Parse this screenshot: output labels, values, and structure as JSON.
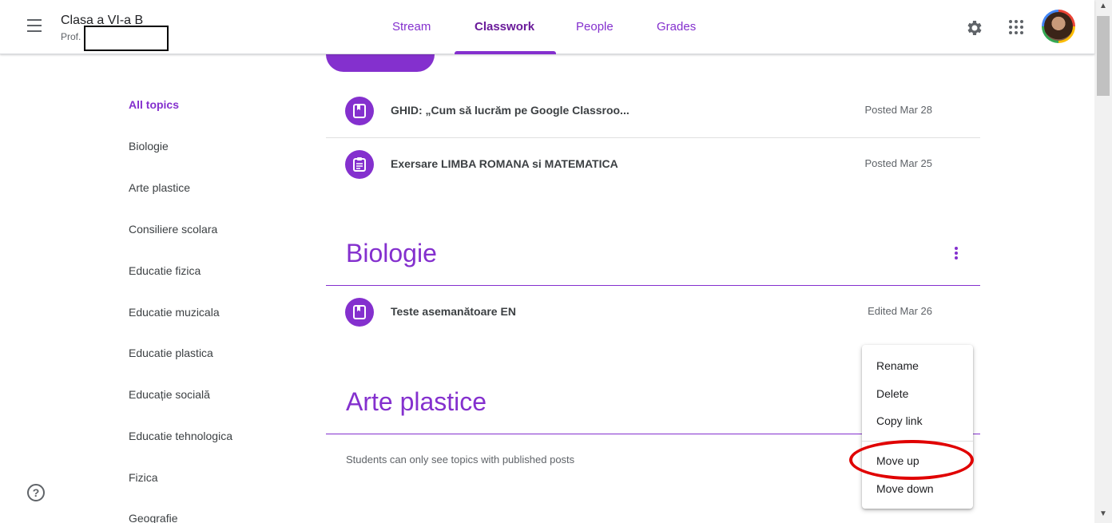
{
  "header": {
    "class_name": "Clasa a VI-a B",
    "teacher_prefix": "Prof.",
    "tabs": [
      {
        "label": "Stream"
      },
      {
        "label": "Classwork"
      },
      {
        "label": "People"
      },
      {
        "label": "Grades"
      }
    ],
    "active_tab": "Classwork"
  },
  "topics": {
    "items": [
      {
        "label": "All topics"
      },
      {
        "label": "Biologie"
      },
      {
        "label": "Arte plastice"
      },
      {
        "label": "Consiliere scolara"
      },
      {
        "label": "Educatie fizica"
      },
      {
        "label": "Educatie muzicala"
      },
      {
        "label": "Educatie plastica"
      },
      {
        "label": "Educație socială"
      },
      {
        "label": "Educatie tehnologica"
      },
      {
        "label": "Fizica"
      },
      {
        "label": "Geografie"
      }
    ],
    "active": "All topics"
  },
  "posts": [
    {
      "icon": "material-icon",
      "title": "GHID: „Cum să lucrăm pe Google Classroo...",
      "date": "Posted Mar 28"
    },
    {
      "icon": "assignment-icon",
      "title": "Exersare LIMBA ROMANA si MATEMATICA",
      "date": "Posted Mar 25"
    }
  ],
  "sections": [
    {
      "title": "Biologie",
      "posts": [
        {
          "icon": "material-icon",
          "title": "Teste asemanătoare EN",
          "date": "Edited Mar 26"
        }
      ]
    },
    {
      "title": "Arte plastice",
      "notice": "Students can only see topics with published posts"
    }
  ],
  "context_menu": {
    "items": [
      {
        "label": "Rename"
      },
      {
        "label": "Delete"
      },
      {
        "label": "Copy link"
      },
      {
        "label": "Move up"
      },
      {
        "label": "Move down"
      }
    ],
    "highlighted": "Move up"
  },
  "colors": {
    "accent": "#8430ce",
    "highlight_ring": "#e00000"
  }
}
